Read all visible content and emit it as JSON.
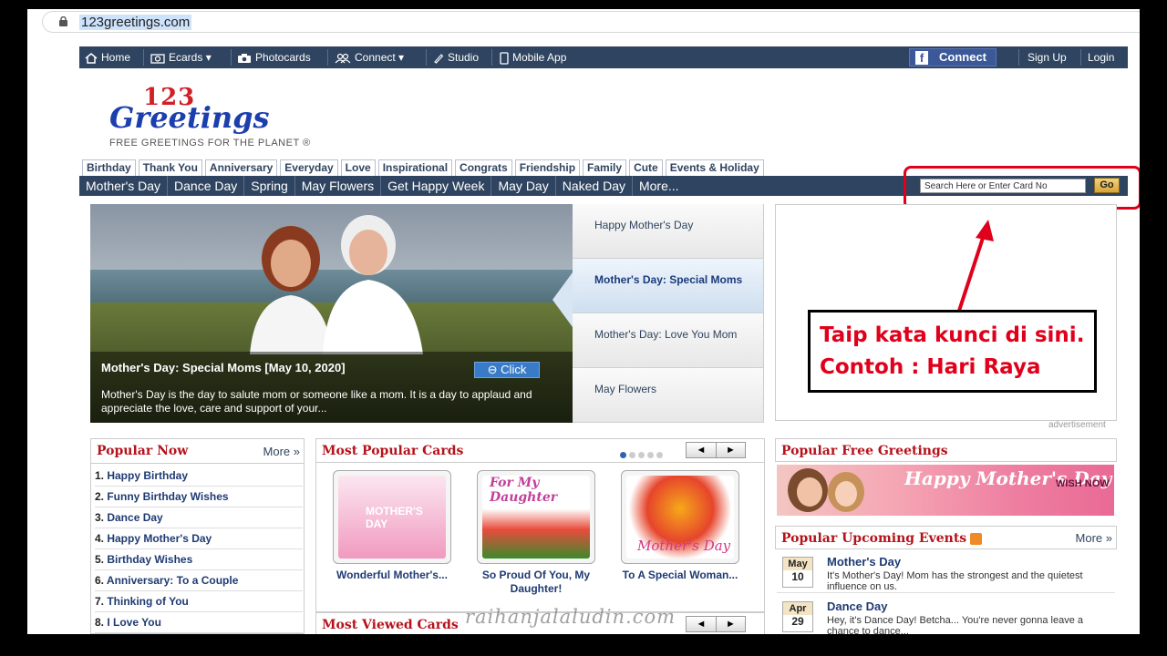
{
  "browser": {
    "url": "123greetings.com"
  },
  "topnav": {
    "home": "Home",
    "ecards": "Ecards",
    "photocards": "Photocards",
    "connect": "Connect",
    "studio": "Studio",
    "mobile_app": "Mobile App",
    "fb_connect": "Connect",
    "sign_up": "Sign Up",
    "login": "Login"
  },
  "logo": {
    "line1": "123",
    "line2": "Greetings",
    "tagline": "FREE GREETINGS FOR THE PLANET ®"
  },
  "category_tabs": [
    "Birthday",
    "Thank You",
    "Anniversary",
    "Everyday",
    "Love",
    "Inspirational",
    "Congrats",
    "Friendship",
    "Family",
    "Cute",
    "Events & Holiday"
  ],
  "subnav": [
    "Mother's Day",
    "Dance Day",
    "Spring",
    "May Flowers",
    "Get Happy Week",
    "May Day",
    "Naked Day",
    "More..."
  ],
  "search": {
    "placeholder": "Search Here or Enter Card No",
    "go": "Go"
  },
  "hero": {
    "title": "Mother's Day: Special Moms [May 10, 2020]",
    "click": "Click",
    "body": "Mother's Day is the day to salute mom or someone like a mom. It is a day to applaud and appreciate the love, care and support of your...",
    "list": [
      "Happy Mother's Day",
      "Mother's Day: Special Moms",
      "Mother's Day: Love You Mom",
      "May Flowers"
    ]
  },
  "ad": {
    "label": "advertisement"
  },
  "annotation": {
    "line1": "Taip kata kunci di sini.",
    "line2": "Contoh : Hari Raya"
  },
  "popular_now": {
    "title": "Popular Now",
    "more": "More »",
    "items": [
      "Happy Birthday",
      "Funny Birthday Wishes",
      "Dance Day",
      "Happy Mother's Day",
      "Birthday Wishes",
      "Anniversary: To a Couple",
      "Thinking of You",
      "I Love You"
    ]
  },
  "most_popular_cards": {
    "title": "Most Popular Cards",
    "cards": [
      {
        "caption": "Wonderful Mother's...",
        "art": "MOTHER'S DAY"
      },
      {
        "caption": "So Proud Of You, My Daughter!",
        "art": "For My Daughter"
      },
      {
        "caption": "To A Special Woman...",
        "art": "Mother's Day"
      }
    ]
  },
  "most_viewed_cards": {
    "title": "Most Viewed Cards"
  },
  "popular_free_greetings": {
    "title": "Popular Free Greetings",
    "banner_text": "Happy Mother's Day",
    "banner_cta": "WISH NOW"
  },
  "upcoming_events": {
    "title": "Popular Upcoming Events",
    "more": "More »",
    "events": [
      {
        "month": "May",
        "day": "10",
        "name": "Mother's Day",
        "desc": "It's Mother's Day! Mom has the strongest and the quietest influence on us."
      },
      {
        "month": "Apr",
        "day": "29",
        "name": "Dance Day",
        "desc": "Hey, it's Dance Day! Betcha... You're never gonna leave a chance to dance..."
      }
    ]
  },
  "watermark": "raihanjalaludin.com",
  "colors": {
    "nav": "#2f4460",
    "accent_red": "#b5121b",
    "link": "#1f3b73",
    "annotation_red": "#e0001b"
  }
}
